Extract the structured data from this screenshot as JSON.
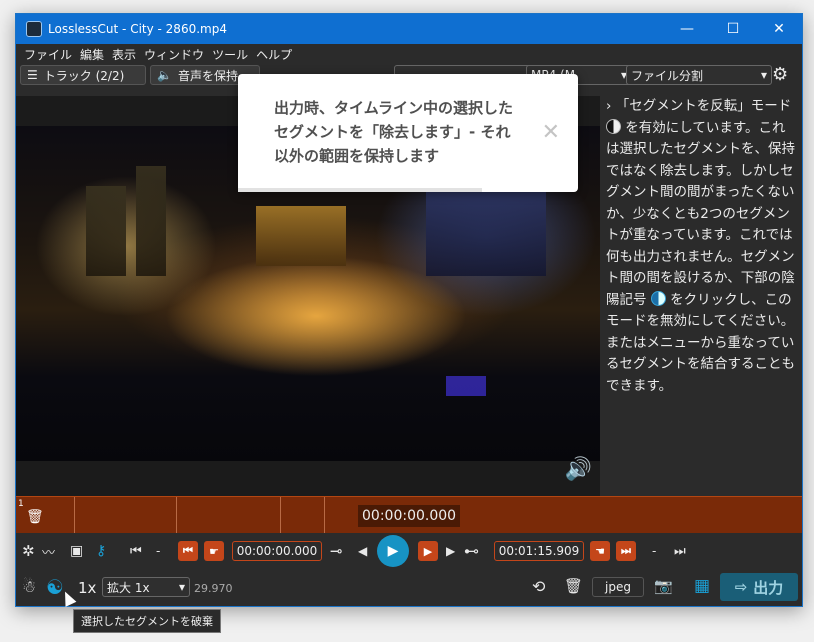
{
  "titlebar": {
    "title": "LosslessCut - City - 2860.mp4",
    "minimize": "—",
    "maximize": "☐",
    "close": "✕"
  },
  "menu": [
    "ファイル",
    "編集",
    "表示",
    "ウィンドウ",
    "ツール",
    "ヘルプ"
  ],
  "toolbar": {
    "tracks_label": "トラック (2/2)",
    "audio_label": "音声を保持",
    "format_label": "MP4 (M",
    "output_mode": "ファイル分割"
  },
  "popup": {
    "message": "出力時、タイムライン中の選択したセグメントを「除去します」- それ以外の範囲を保持します",
    "close": "✕"
  },
  "side_panel": {
    "part1": "「セグメントを反転」モード",
    "part2": "を有効にしています。これは選択したセグメントを、保持ではなく除去します。しかしセグメント間の間がまったくないか、少なくとも2つのセグメントが重なっています。これでは何も出力されません。セグメント間の間を設けるか、下部の陰陽記号",
    "part3": "をクリックし、このモードを無効にしてください。またはメニューから重なっているセグメントを結合することもできます。"
  },
  "timeline": {
    "current_time": "00:00:00.000",
    "segment_marker": "1"
  },
  "controls": {
    "dash1": "-",
    "start_time": "00:00:00.000",
    "end_time": "00:01:15.909",
    "dash2": "-"
  },
  "bottom": {
    "speed": "1x",
    "zoom_label": "拡大 1x",
    "fps": "29.970",
    "capture_format": "jpeg",
    "export_label": "出力"
  },
  "tooltip": "選択したセグメントを破棄",
  "colors": {
    "accent": "#1793c4",
    "segment": "#7a2a08",
    "orange": "#c4461a",
    "titlebar": "#0f6fd1"
  }
}
